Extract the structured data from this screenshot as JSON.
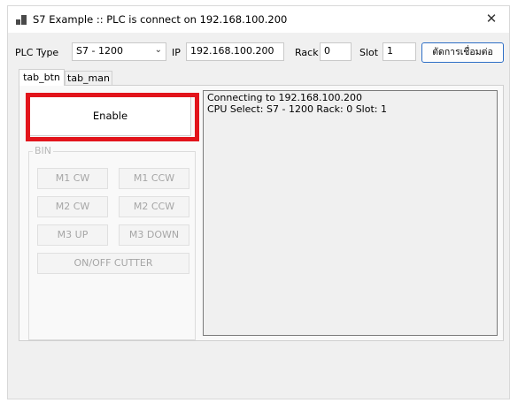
{
  "window": {
    "title": "S7 Example :: PLC is connect on 192.168.100.200",
    "close_glyph": "✕"
  },
  "toolbar": {
    "plc_type_label": "PLC Type",
    "plc_type_value": "S7 - 1200",
    "ip_label": "IP",
    "ip_value": "192.168.100.200",
    "rack_label": "Rack",
    "rack_value": "0",
    "slot_label": "Slot",
    "slot_value": "1",
    "disconnect_label": "ตัดการเชื่อมต่อ"
  },
  "tabs": [
    {
      "label": "tab_btn",
      "active": true
    },
    {
      "label": "tab_man",
      "active": false
    }
  ],
  "panel": {
    "enable_label": "Enable",
    "group_legend": "BIN",
    "buttons": {
      "m1_cw": "M1 CW",
      "m1_ccw": "M1 CCW",
      "m2_cw": "M2 CW",
      "m2_ccw": "M2 CCW",
      "m3_up": "M3 UP",
      "m3_down": "M3 DOWN",
      "cutter": "ON/OFF CUTTER"
    },
    "log_lines": [
      "Connecting to 192.168.100.200",
      "CPU Select: S7 - 1200 Rack: 0 Slot: 1"
    ]
  },
  "colors": {
    "highlight": "#e2141b",
    "connect_border": "#2f6fc6",
    "disabled_text": "#a6a6a6"
  },
  "icons": {
    "app": "app-window-icon",
    "combo_arrow": "chevron-down-icon",
    "close": "close-icon"
  }
}
